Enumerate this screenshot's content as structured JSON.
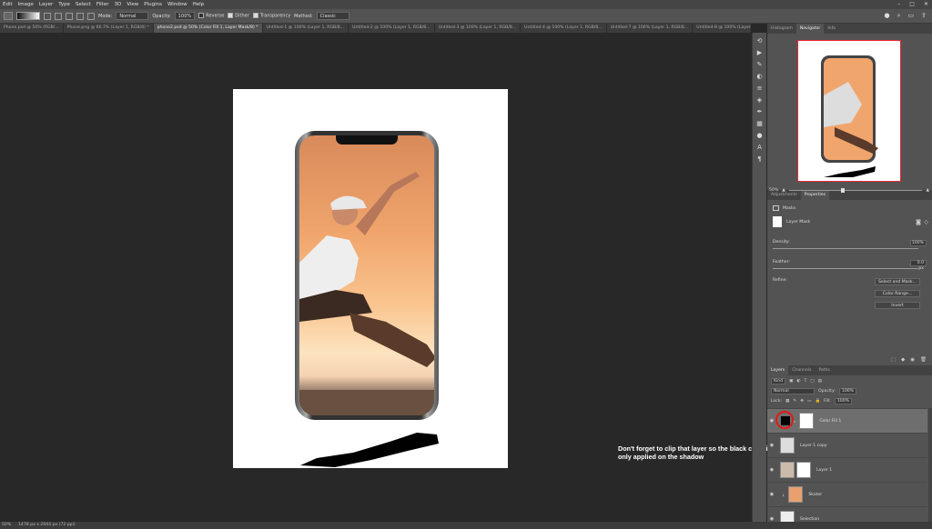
{
  "menu": [
    "Edit",
    "Image",
    "Layer",
    "Type",
    "Select",
    "Filter",
    "3D",
    "View",
    "Plugins",
    "Window",
    "Help"
  ],
  "options": {
    "mode_label": "Mode:",
    "mode_value": "Normal",
    "opacity_label": "Opacity:",
    "opacity_value": "100%",
    "reverse_label": "Reverse",
    "dither_label": "Dither",
    "transparency_label": "Transparency",
    "method_label": "Method:",
    "method_value": "Classic"
  },
  "tabs": [
    {
      "label": "Phone.psd @ 50% (RGB/...",
      "active": false
    },
    {
      "label": "Phone.png @ 66.7% (Layer 1, RGB/8) *",
      "active": false
    },
    {
      "label": "phone2.psd @ 50% (Color Fill 1, Layer Mask/8) *",
      "active": true
    },
    {
      "label": "Untitled-1 @ 100% (Layer 1, RGB/8...",
      "active": false
    },
    {
      "label": "Untitled-2 @ 100% (Layer 1, RGB/8...",
      "active": false
    },
    {
      "label": "Untitled-3 @ 100% (Layer 1, RGB/8...",
      "active": false
    },
    {
      "label": "Untitled-4 @ 100% (Layer 1, RGB/8...",
      "active": false
    },
    {
      "label": "Untitled-7 @ 100% (Layer 1, RGB/8...",
      "active": false
    },
    {
      "label": "Untitled-8 @ 100% (Layer 1, RGB/8...",
      "active": false
    }
  ],
  "annotation": "Don't forget to clip that layer so the black color is only applied on the shadow",
  "panel_tabs_top": [
    "Histogram",
    "Navigator",
    "Info"
  ],
  "navigator": {
    "zoom": "50%"
  },
  "panel_tabs_mid": [
    "Adjustments",
    "Properties"
  ],
  "properties": {
    "masks_label": "Masks",
    "layer_mask_label": "Layer Mask",
    "density_label": "Density:",
    "density_value": "100%",
    "feather_label": "Feather:",
    "feather_value": "0.0 px",
    "refine_label": "Refine:",
    "select_mask_btn": "Select and Mask...",
    "color_range_btn": "Color Range...",
    "invert_btn": "Invert"
  },
  "panel_tabs_layers": [
    "Layers",
    "Channels",
    "Paths"
  ],
  "layers_bar": {
    "kind": "Kind",
    "blend": "Normal",
    "opacity_label": "Opacity:",
    "opacity_value": "100%",
    "lock_label": "Lock:",
    "fill_label": "Fill:",
    "fill_value": "100%"
  },
  "layers": [
    {
      "name": "Color Fill 1",
      "selected": true
    },
    {
      "name": "Layer 1 copy",
      "selected": false
    },
    {
      "name": "Layer 1",
      "selected": false
    },
    {
      "name": "Skater",
      "selected": false
    },
    {
      "name": "Selection",
      "selected": false
    }
  ],
  "status": {
    "zoom": "50%",
    "doc": "1478 px x 2044 px (72 ppi)"
  }
}
